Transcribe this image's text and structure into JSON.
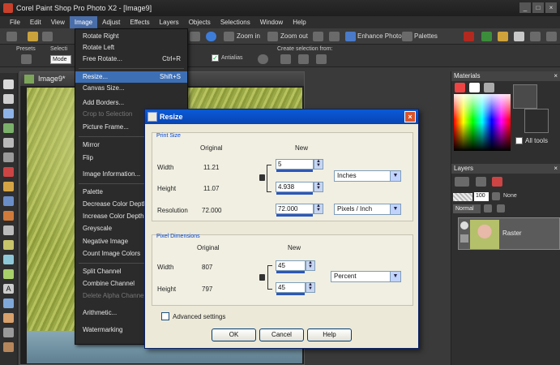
{
  "app": {
    "title": "Corel Paint Shop Pro Photo X2 - [Image9]"
  },
  "menubar": {
    "items": [
      {
        "label": "File"
      },
      {
        "label": "Edit"
      },
      {
        "label": "View"
      },
      {
        "label": "Image"
      },
      {
        "label": "Adjust"
      },
      {
        "label": "Effects"
      },
      {
        "label": "Layers"
      },
      {
        "label": "Objects"
      },
      {
        "label": "Selections"
      },
      {
        "label": "Window"
      },
      {
        "label": "Help"
      }
    ]
  },
  "toolbar": {
    "enhance_photo": "Enhance Photo",
    "palettes": "Palettes"
  },
  "options": {
    "presets_label": "Presets",
    "selection_label": "Selecti",
    "mode_value": "Mode",
    "antialias_label": "Antialias",
    "create_selection_label": "Create selection from:"
  },
  "image_window": {
    "title": "Image9*"
  },
  "image_menu": {
    "items": [
      {
        "label": "Rotate Right",
        "shortcut": "",
        "state": "normal"
      },
      {
        "label": "Rotate Left",
        "shortcut": "",
        "state": "normal"
      },
      {
        "label": "Free Rotate...",
        "shortcut": "Ctrl+R",
        "state": "normal"
      },
      {
        "label": "Resize...",
        "shortcut": "Shift+S",
        "state": "highlight"
      },
      {
        "label": "Canvas Size...",
        "shortcut": "",
        "state": "normal"
      },
      {
        "label": "Add Borders...",
        "shortcut": "",
        "state": "normal"
      },
      {
        "label": "Crop to Selection",
        "shortcut": "",
        "state": "disabled"
      },
      {
        "label": "Picture Frame...",
        "shortcut": "",
        "state": "normal"
      },
      {
        "label": "Mirror",
        "shortcut": "",
        "state": "normal"
      },
      {
        "label": "Flip",
        "shortcut": "",
        "state": "normal"
      },
      {
        "label": "Image Information...",
        "shortcut": "",
        "state": "normal"
      },
      {
        "label": "Palette",
        "shortcut": "",
        "state": "normal"
      },
      {
        "label": "Decrease Color Depth",
        "shortcut": "",
        "state": "normal"
      },
      {
        "label": "Increase Color Depth",
        "shortcut": "",
        "state": "normal"
      },
      {
        "label": "Greyscale",
        "shortcut": "",
        "state": "normal"
      },
      {
        "label": "Negative Image",
        "shortcut": "",
        "state": "normal"
      },
      {
        "label": "Count Image Colors",
        "shortcut": "",
        "state": "normal"
      },
      {
        "label": "Split Channel",
        "shortcut": "",
        "state": "normal"
      },
      {
        "label": "Combine Channel",
        "shortcut": "",
        "state": "normal"
      },
      {
        "label": "Delete Alpha Channel",
        "shortcut": "",
        "state": "disabled"
      },
      {
        "label": "Arithmetic...",
        "shortcut": "",
        "state": "normal"
      },
      {
        "label": "Watermarking",
        "shortcut": "",
        "state": "normal"
      }
    ]
  },
  "materials": {
    "title": "Materials",
    "all_tools_label": "All tools"
  },
  "layers": {
    "title": "Layers",
    "opacity_value": "100",
    "blend_mode": "Normal",
    "none_label": "None",
    "layer_name": "Raster"
  },
  "resize_dialog": {
    "title": "Resize",
    "print_size": {
      "group_label": "Print Size",
      "original_header": "Original",
      "new_header": "New",
      "width_label": "Width",
      "width_original": "11.21",
      "width_new": "5",
      "height_label": "Height",
      "height_original": "11.07",
      "height_new": "4.938",
      "resolution_label": "Resolution",
      "resolution_original": "72.000",
      "resolution_new": "72.000",
      "units": "Inches",
      "resolution_units": "Pixels / Inch"
    },
    "pixel_dimensions": {
      "group_label": "Pixel Dimensions",
      "original_header": "Original",
      "new_header": "New",
      "width_label": "Width",
      "width_original": "807",
      "width_new": "45",
      "height_label": "Height",
      "height_original": "797",
      "height_new": "45",
      "units": "Percent"
    },
    "advanced_label": "Advanced settings",
    "ok_label": "OK",
    "cancel_label": "Cancel",
    "help_label": "Help"
  }
}
